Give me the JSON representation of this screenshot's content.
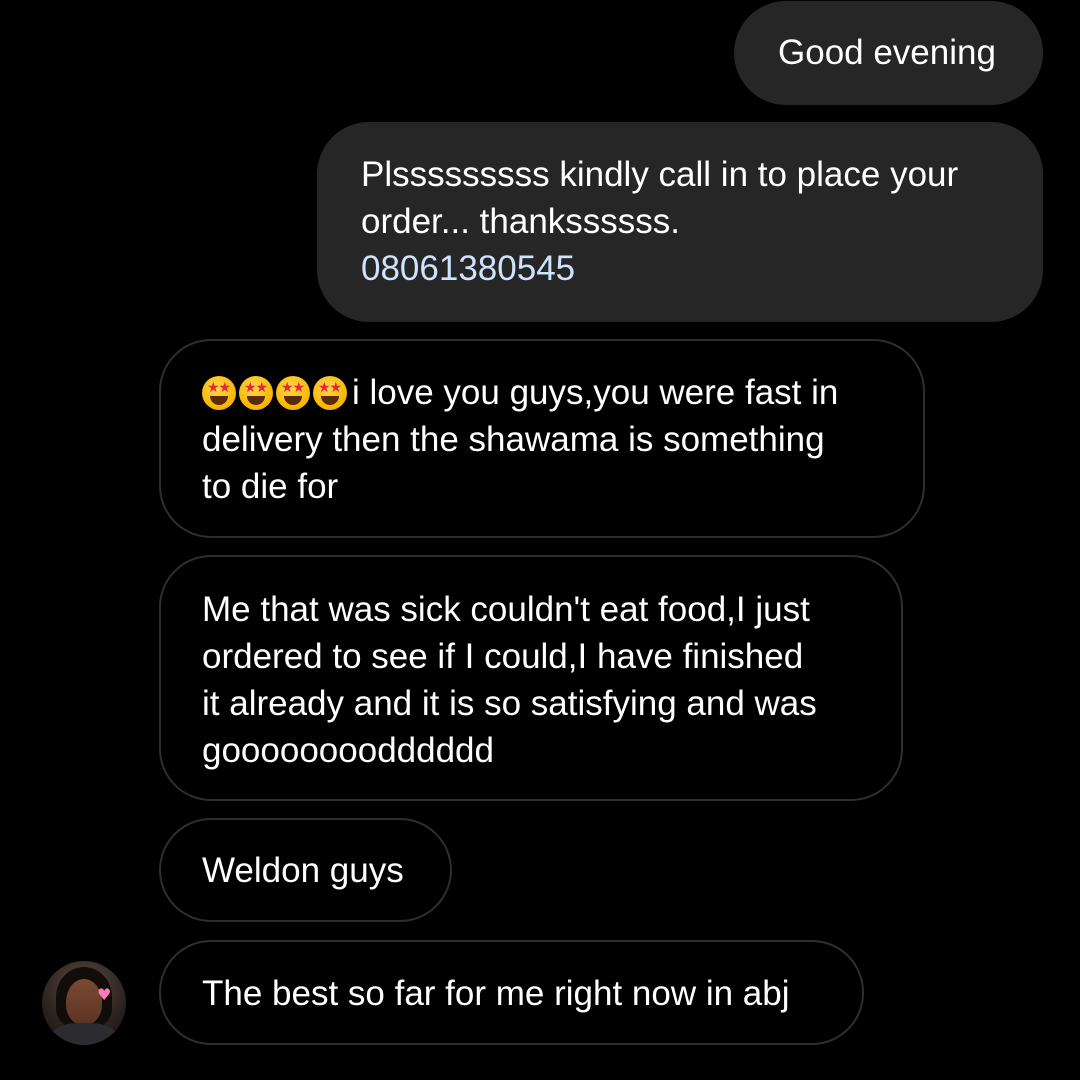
{
  "conversation": {
    "sent": [
      {
        "lines": [
          "Good evening"
        ]
      },
      {
        "lines": [
          "Plsssssssss kindly call in to place your",
          "order... thankssssss."
        ],
        "phone": "08061380545"
      }
    ],
    "received": [
      {
        "emoji_prefix": [
          "star-struck-emoji",
          "star-struck-emoji",
          "star-struck-emoji",
          "star-struck-emoji"
        ],
        "lines": [
          "i love you guys,you were fast in",
          "delivery then the shawama is something",
          "to die for"
        ]
      },
      {
        "lines": [
          "Me that was sick couldn't eat food,I just",
          "ordered to see if I could,I have finished",
          "it already and it is so satisfying and was",
          "goooooooodddddd"
        ]
      },
      {
        "lines": [
          "Weldon guys"
        ]
      },
      {
        "lines": [
          "The best so far for me right now in abj"
        ]
      }
    ]
  },
  "colors": {
    "background": "#000000",
    "sent_bubble": "#262626",
    "received_border": "#2e2e2e",
    "text": "#ffffff",
    "phone_link": "#cfe3ff"
  },
  "avatar": {
    "icon": "profile-photo"
  }
}
